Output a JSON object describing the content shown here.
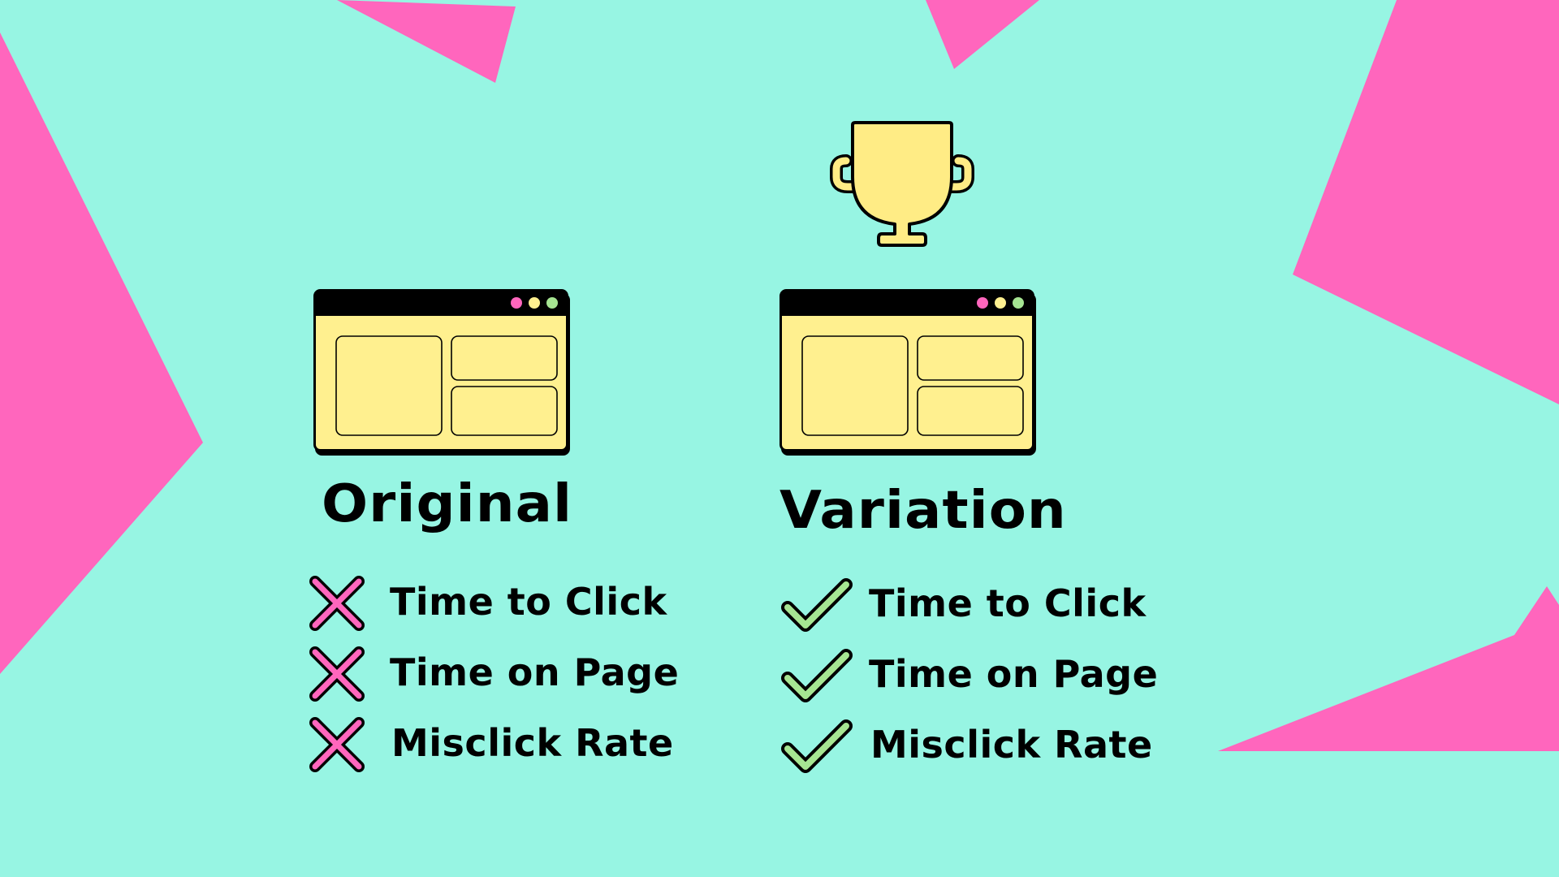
{
  "colors": {
    "background": "#97F5E3",
    "accent_pink": "#FF66BD",
    "window_fill": "#FFF08F",
    "dot_pink": "#FF66BD",
    "dot_yellow": "#FFF08F",
    "dot_green": "#A6E592",
    "check_green": "#A6E592",
    "trophy_gold": "#FFEC85"
  },
  "trophy": {
    "icon": "trophy-icon"
  },
  "original": {
    "title": "Original",
    "status_icon": "x-mark-icon",
    "metrics": [
      "Time to Click",
      "Time on Page",
      "Misclick Rate"
    ]
  },
  "variation": {
    "title": "Variation",
    "status_icon": "checkmark-icon",
    "metrics": [
      "Time to Click",
      "Time on Page",
      "Misclick Rate"
    ]
  }
}
